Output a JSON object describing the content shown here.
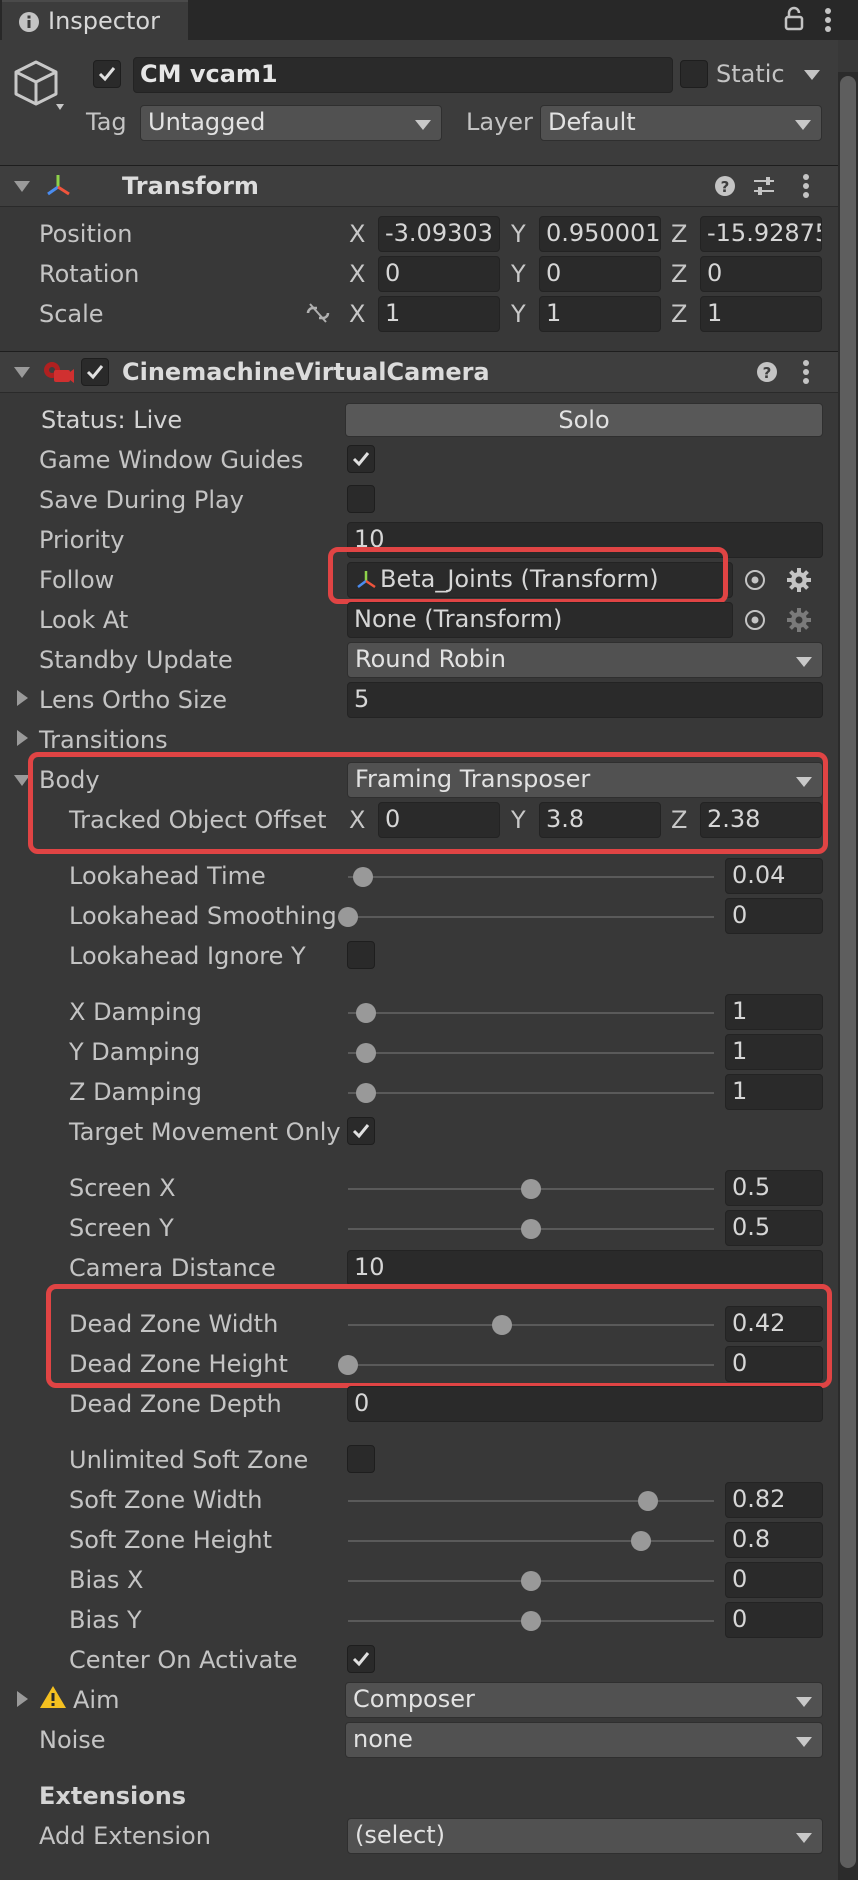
{
  "window": {
    "tab_title": "Inspector"
  },
  "object": {
    "name": "CM vcam1",
    "static_label": "Static",
    "tag_label": "Tag",
    "tag_value": "Untagged",
    "layer_label": "Layer",
    "layer_value": "Default"
  },
  "transform": {
    "title": "Transform",
    "position_label": "Position",
    "rotation_label": "Rotation",
    "scale_label": "Scale",
    "axes": {
      "x": "X",
      "y": "Y",
      "z": "Z"
    },
    "position": {
      "x": "-3.09303",
      "y": "0.950001",
      "z": "-15.92875"
    },
    "rotation": {
      "x": "0",
      "y": "0",
      "z": "0"
    },
    "scale": {
      "x": "1",
      "y": "1",
      "z": "1"
    }
  },
  "vcam": {
    "title": "CinemachineVirtualCamera",
    "status_label": "Status: Live",
    "solo_button": "Solo",
    "game_window_guides": "Game Window Guides",
    "save_during_play": "Save During Play",
    "priority_label": "Priority",
    "priority_value": "10",
    "follow_label": "Follow",
    "follow_value": "Beta_Joints (Transform)",
    "lookat_label": "Look At",
    "lookat_value": "None (Transform)",
    "standby_label": "Standby Update",
    "standby_value": "Round Robin",
    "lens_label": "Lens Ortho Size",
    "lens_value": "5",
    "transitions_label": "Transitions",
    "body_label": "Body",
    "body_value": "Framing Transposer",
    "tracked_label": "Tracked Object Offset",
    "tracked": {
      "x": "0",
      "y": "3.8",
      "z": "2.38"
    },
    "lookahead_time_label": "Lookahead Time",
    "lookahead_time": "0.04",
    "lookahead_smoothing_label": "Lookahead Smoothing",
    "lookahead_smoothing": "0",
    "lookahead_ignore_y_label": "Lookahead Ignore Y",
    "x_damping_label": "X Damping",
    "x_damping": "1",
    "y_damping_label": "Y Damping",
    "y_damping": "1",
    "z_damping_label": "Z Damping",
    "z_damping": "1",
    "target_movement_label": "Target Movement Only",
    "screen_x_label": "Screen X",
    "screen_x": "0.5",
    "screen_y_label": "Screen Y",
    "screen_y": "0.5",
    "camera_distance_label": "Camera Distance",
    "camera_distance": "10",
    "dead_zone_width_label": "Dead Zone Width",
    "dead_zone_width": "0.42",
    "dead_zone_height_label": "Dead Zone Height",
    "dead_zone_height": "0",
    "dead_zone_depth_label": "Dead Zone Depth",
    "dead_zone_depth": "0",
    "unlimited_soft_zone_label": "Unlimited Soft Zone",
    "soft_zone_width_label": "Soft Zone Width",
    "soft_zone_width": "0.82",
    "soft_zone_height_label": "Soft Zone Height",
    "soft_zone_height": "0.8",
    "bias_x_label": "Bias X",
    "bias_x": "0",
    "bias_y_label": "Bias Y",
    "bias_y": "0",
    "center_on_activate_label": "Center On Activate",
    "aim_label": "Aim",
    "aim_value": "Composer",
    "noise_label": "Noise",
    "noise_value": "none",
    "extensions_label": "Extensions",
    "add_extension_label": "Add Extension",
    "add_extension_value": "(select)"
  },
  "sliders": {
    "lookahead_time": 0.04,
    "lookahead_smoothing": 0,
    "x_damping": 1,
    "y_damping": 1,
    "z_damping": 1,
    "screen_x": 0.5,
    "screen_y": 0.5,
    "dead_zone_width": 0.42,
    "dead_zone_height": 0,
    "soft_zone_width": 0.82,
    "soft_zone_height": 0.8,
    "bias_x": 0,
    "bias_y": 0
  },
  "checkboxes": {
    "object_active": true,
    "static": false,
    "vcam_enabled": true,
    "game_window_guides": true,
    "save_during_play": false,
    "lookahead_ignore_y": false,
    "target_movement_only": true,
    "unlimited_soft_zone": false,
    "center_on_activate": true
  },
  "colors": {
    "highlight": "#e04444",
    "background": "#383838",
    "field": "#2a2a2a"
  }
}
